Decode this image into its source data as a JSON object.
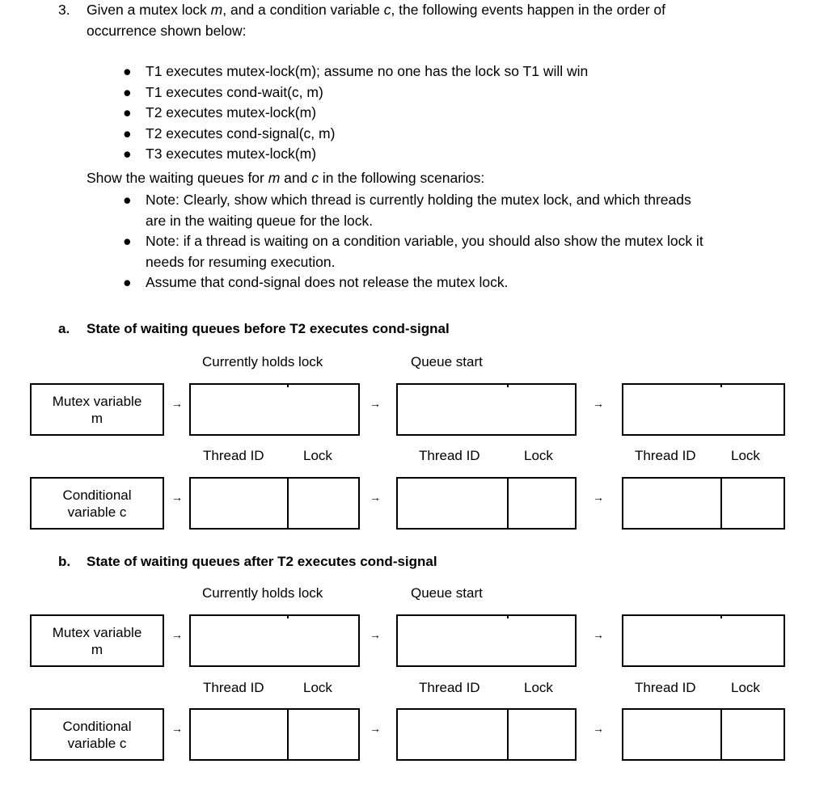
{
  "question": {
    "number": "3.",
    "intro_line1": "Given a mutex lock m, and a condition variable c, the following events happen in the order of",
    "intro_line2": "occurrence shown below:",
    "intro_part_a": "Given a mutex lock ",
    "intro_var_m": "m",
    "intro_part_b": ", and a condition variable ",
    "intro_var_c": "c",
    "intro_part_c": ", the following events happen in the order of",
    "events": [
      "T1 executes mutex-lock(m); assume no one has the lock so T1 will win",
      "T1 executes cond-wait(c, m)",
      "T2 executes mutex-lock(m)",
      "T2 executes cond-signal(c, m)",
      "T3 executes mutex-lock(m)"
    ],
    "show_line_part_a": "Show the waiting queues for ",
    "show_line_var_m": "m",
    "show_line_part_b": " and ",
    "show_line_var_c": "c",
    "show_line_part_c": " in the following scenarios:",
    "notes": [
      {
        "line1": "Note: Clearly, show which thread is currently holding the mutex lock, and which threads",
        "line2": "are in the waiting queue for the lock."
      },
      {
        "line1": "Note: if a thread is waiting on a condition variable, you should also show the mutex lock it",
        "line2": "needs for resuming execution."
      },
      {
        "line1": "Assume that cond-signal does not release the mutex lock.",
        "line2": ""
      }
    ],
    "bullet_glyph": "●"
  },
  "sections": [
    {
      "marker": "a.",
      "title": "State of waiting queues before T2 executes cond-signal",
      "captions": {
        "currently_holds_lock": "Currently holds lock",
        "queue_start": "Queue start"
      },
      "mutex_row": {
        "label_line1": "Mutex variable",
        "label_line2": "m"
      },
      "cond_row": {
        "label_line1": "Conditional",
        "label_line2": "variable c"
      },
      "column_headers": [
        {
          "thread_id": "Thread ID",
          "lock": "Lock"
        },
        {
          "thread_id": "Thread ID",
          "lock": "Lock"
        },
        {
          "thread_id": "Thread ID",
          "lock": "Lock"
        }
      ],
      "arrow_glyph": "→"
    },
    {
      "marker": "b.",
      "title": "State of waiting queues after T2 executes cond-signal",
      "captions": {
        "currently_holds_lock": "Currently holds lock",
        "queue_start": "Queue start"
      },
      "mutex_row": {
        "label_line1": "Mutex variable",
        "label_line2": "m"
      },
      "cond_row": {
        "label_line1": "Conditional",
        "label_line2": "variable c"
      },
      "column_headers": [
        {
          "thread_id": "Thread ID",
          "lock": "Lock"
        },
        {
          "thread_id": "Thread ID",
          "lock": "Lock"
        },
        {
          "thread_id": "Thread ID",
          "lock": "Lock"
        }
      ],
      "arrow_glyph": "→"
    }
  ],
  "colors": {
    "ink": "#000000",
    "paper": "#ffffff"
  }
}
